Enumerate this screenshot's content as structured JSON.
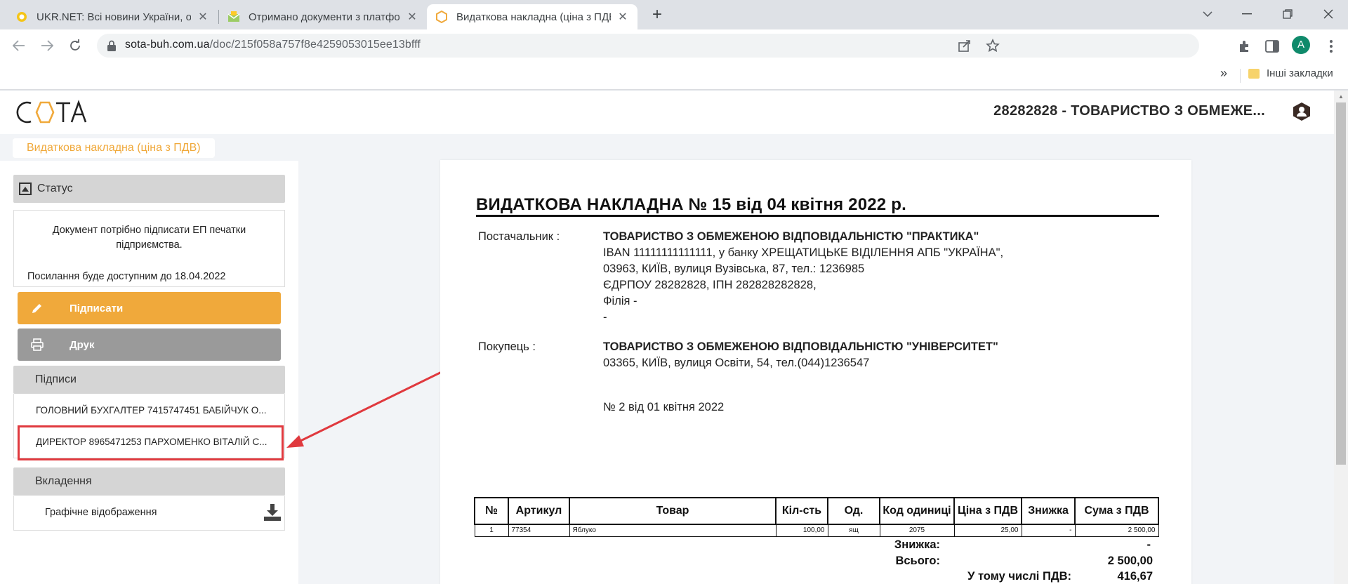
{
  "browser": {
    "tabs": [
      {
        "title": "UKR.NET: Всі новини України, ос",
        "icon": "ukrnet-favicon"
      },
      {
        "title": "Отримано документи з платфор",
        "icon": "mail-favicon"
      },
      {
        "title": "Видаткова накладна (ціна з ПДВ",
        "icon": "sota-favicon"
      }
    ],
    "url_host": "sota-buh.com.ua",
    "url_path": "/doc/215f058a757f8e4259053015ee13bfff",
    "avatar_letter": "A",
    "bookmarks_overflow": "»",
    "bookmarks_folder": "Інші закладки"
  },
  "app": {
    "logo_text": "СОТА",
    "company": "28282828 - ТОВАРИСТВО З ОБМЕЖЕ...",
    "doc_type": "Видаткова накладна (ціна з ПДВ)"
  },
  "sidebar": {
    "status_title": "Статус",
    "status_message": "Документ потрібно підписати ЕП печатки підприємства.",
    "status_until": "Посилання буде доступним до 18.04.2022",
    "sign_button": "Підписати",
    "print_button": "Друк",
    "signatures_title": "Підписи",
    "signatures": [
      "ГОЛОВНИЙ БУХГАЛТЕР 7415747451 БАБІЙЧУК О...",
      "ДИРЕКТОР 8965471253 ПАРХОМЕНКО ВІТАЛІЙ С..."
    ],
    "attachments_title": "Вкладення",
    "attachment": "Графічне відображення"
  },
  "document": {
    "title": "ВИДАТКОВА НАКЛАДНА №  15 від 04 квітня 2022 р.",
    "supplier_label": "Постачальник :",
    "supplier_name": "ТОВАРИСТВО З ОБМЕЖЕНОЮ ВІДПОВІДАЛЬНІСТЮ \"ПРАКТИКА\"",
    "supplier_lines": [
      "IBAN 11111111111111, у банку ХРЕЩАТИЦЬКЕ ВІДІЛЕННЯ АПБ \"УКРАЇНА\",",
      "03963, КИЇВ, вулиця Вузівська, 87, тел.: 1236985",
      "ЄДРПОУ 28282828, ІПН 282828282828,",
      "Філія -",
      "-"
    ],
    "buyer_label": "Покупець :",
    "buyer_name": "ТОВАРИСТВО З ОБМЕЖЕНОЮ ВІДПОВІДАЛЬНІСТЮ \"УНІВЕРСИТЕТ\"",
    "buyer_address": "03365, КИЇВ, вулиця Освіти, 54, тел.(044)1236547",
    "contract": "№ 2 від 01 квітня 2022",
    "table_headers": [
      "№",
      "Артикул",
      "Товар",
      "Кіл-сть",
      "Од.",
      "Код одиниці",
      "Ціна з ПДВ",
      "Знижка",
      "Сума з ПДВ"
    ],
    "rows": [
      [
        "1",
        "77354",
        "Яблуко",
        "100,00",
        "ящ",
        "2075",
        "25,00",
        "-",
        "2 500,00"
      ]
    ],
    "totals": [
      {
        "label": "Знижка:",
        "value": "-"
      },
      {
        "label": "Всього:",
        "value": "2 500,00"
      },
      {
        "label": "У тому числі ПДВ:",
        "value": "416,67"
      }
    ]
  },
  "colors": {
    "accent_orange": "#f0a93b",
    "print_gray": "#9a9a9a",
    "highlight_red": "#e0393e"
  }
}
